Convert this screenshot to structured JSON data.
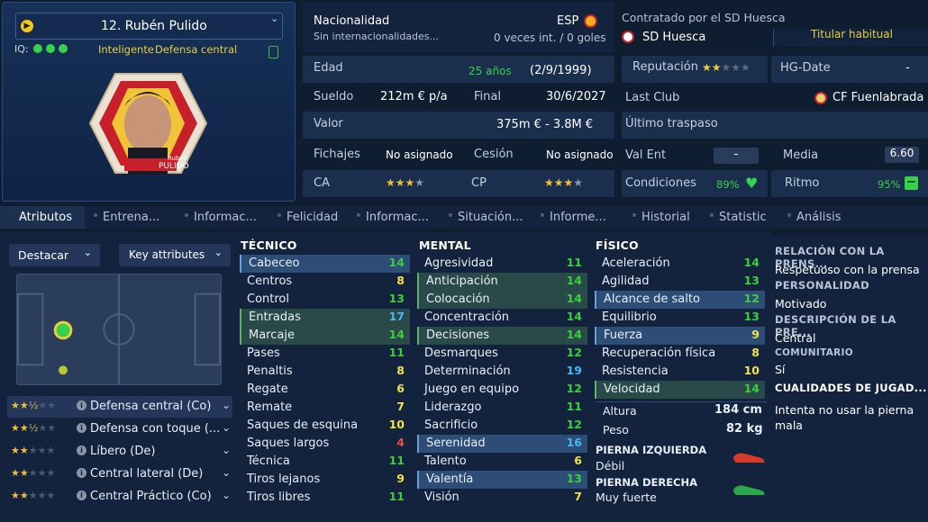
{
  "player": {
    "name": "12. Rubén Pulido",
    "iq_label": "IQ:",
    "trait1": "Inteligente",
    "trait2": "Defensa central",
    "portrait_first": "Rubén",
    "portrait_last": "PULIDO"
  },
  "info": {
    "nationality_label": "Nacionalidad",
    "nationality_code": "ESP",
    "caps_text": "Sin internacionalidades...",
    "caps_count": "0 veces int. / 0 goles",
    "contracted_label": "Contratado por el SD Huesca",
    "club": "SD Huesca",
    "status": "Titular habitual",
    "age_label": "Edad",
    "age": "25 años",
    "dob": "(2/9/1999)",
    "reputation_label": "Reputación",
    "reputation_stars": "★★☆☆☆",
    "hg_label": "HG-Date",
    "hg_value": "-",
    "wage_label": "Sueldo",
    "wage": "212m € p/a",
    "end_label": "Final",
    "end": "30/6/2027",
    "lastclub_label": "Last Club",
    "lastclub": "CF Fuenlabrada",
    "value_label": "Valor",
    "value": "375m € - 3.8M €",
    "lasttransfer_label": "Último traspaso",
    "lasttransfer": "",
    "signings_label": "Fichajes",
    "signings": "No asignado",
    "loan_label": "Cesión",
    "loan": "No asignado",
    "valent_label": "Val Ent",
    "valent": "-",
    "media_label": "Media",
    "media": "6.60",
    "ca_label": "CA",
    "ca_stars": "3.5",
    "cp_label": "CP",
    "cp_stars": "3.5",
    "condition_label": "Condiciones",
    "condition": "89%",
    "rhythm_label": "Ritmo",
    "rhythm": "95%"
  },
  "tabs": [
    "Atributos",
    "Entrena...",
    "Informac...",
    "Felicidad",
    "Informac...",
    "Situación...",
    "Informe...",
    "Historial",
    "Statistic",
    "Análisis"
  ],
  "controls": {
    "highlight": "Destacar",
    "key_attributes": "Key attributes"
  },
  "roles": [
    {
      "stars": "2.5",
      "name": "Defensa central (Co)"
    },
    {
      "stars": "2.5",
      "name": "Defensa con toque (..."
    },
    {
      "stars": "2",
      "name": "Líbero (De)"
    },
    {
      "stars": "2",
      "name": "Central lateral (De)"
    },
    {
      "stars": "2",
      "name": "Central Práctico (Co)"
    }
  ],
  "technical": {
    "title": "TÉCNICO",
    "rows": [
      {
        "name": "Cabeceo",
        "value": "14",
        "hl": "b"
      },
      {
        "name": "Centros",
        "value": "8",
        "hl": ""
      },
      {
        "name": "Control",
        "value": "13",
        "hl": ""
      },
      {
        "name": "Entradas",
        "value": "17",
        "hl": "g"
      },
      {
        "name": "Marcaje",
        "value": "14",
        "hl": "g"
      },
      {
        "name": "Pases",
        "value": "11",
        "hl": ""
      },
      {
        "name": "Penaltis",
        "value": "8",
        "hl": ""
      },
      {
        "name": "Regate",
        "value": "6",
        "hl": ""
      },
      {
        "name": "Remate",
        "value": "7",
        "hl": ""
      },
      {
        "name": "Saques de esquina",
        "value": "10",
        "hl": ""
      },
      {
        "name": "Saques largos",
        "value": "4",
        "hl": ""
      },
      {
        "name": "Técnica",
        "value": "11",
        "hl": ""
      },
      {
        "name": "Tiros lejanos",
        "value": "9",
        "hl": ""
      },
      {
        "name": "Tiros libres",
        "value": "11",
        "hl": ""
      }
    ]
  },
  "mental": {
    "title": "MENTAL",
    "rows": [
      {
        "name": "Agresividad",
        "value": "11",
        "hl": ""
      },
      {
        "name": "Anticipación",
        "value": "14",
        "hl": "g"
      },
      {
        "name": "Colocación",
        "value": "14",
        "hl": "g"
      },
      {
        "name": "Concentración",
        "value": "14",
        "hl": ""
      },
      {
        "name": "Decisiones",
        "value": "14",
        "hl": "g"
      },
      {
        "name": "Desmarques",
        "value": "12",
        "hl": ""
      },
      {
        "name": "Determinación",
        "value": "19",
        "hl": ""
      },
      {
        "name": "Juego en equipo",
        "value": "12",
        "hl": ""
      },
      {
        "name": "Liderazgo",
        "value": "11",
        "hl": ""
      },
      {
        "name": "Sacrificio",
        "value": "12",
        "hl": ""
      },
      {
        "name": "Serenidad",
        "value": "16",
        "hl": "b"
      },
      {
        "name": "Talento",
        "value": "6",
        "hl": ""
      },
      {
        "name": "Valentía",
        "value": "13",
        "hl": "b"
      },
      {
        "name": "Visión",
        "value": "7",
        "hl": ""
      }
    ]
  },
  "physical": {
    "title": "FÍSICO",
    "rows": [
      {
        "name": "Aceleración",
        "value": "14",
        "hl": ""
      },
      {
        "name": "Agilidad",
        "value": "13",
        "hl": ""
      },
      {
        "name": "Alcance de salto",
        "value": "12",
        "hl": "b"
      },
      {
        "name": "Equilibrio",
        "value": "13",
        "hl": ""
      },
      {
        "name": "Fuerza",
        "value": "9",
        "hl": "b"
      },
      {
        "name": "Recuperación física",
        "value": "8",
        "hl": ""
      },
      {
        "name": "Resistencia",
        "value": "10",
        "hl": ""
      },
      {
        "name": "Velocidad",
        "value": "14",
        "hl": "g"
      }
    ],
    "height_label": "Altura",
    "height": "184 cm",
    "weight_label": "Peso",
    "weight": "82 kg",
    "left_foot_label": "PIERNA IZQUIERDA",
    "left_foot": "Débil",
    "right_foot_label": "PIERNA DERECHA",
    "right_foot": "Muy fuerte"
  },
  "side": {
    "h1": "RELACIÓN CON LA PRENS...",
    "v1": "Respetuoso con la prensa",
    "h2": "PERSONALIDAD",
    "v2": "Motivado",
    "h3": "DESCRIPCIÓN DE LA PRE...",
    "v3": "Central",
    "h4": "COMUNITARIO",
    "v4": "Sí",
    "h5": "CUALIDADES DE JUGAD...",
    "v5": "Intenta no usar la pierna mala"
  },
  "colors": {
    "accent_green": "#35d24a",
    "accent_yellow": "#e8cf3c",
    "panel": "#1a2f4e"
  }
}
